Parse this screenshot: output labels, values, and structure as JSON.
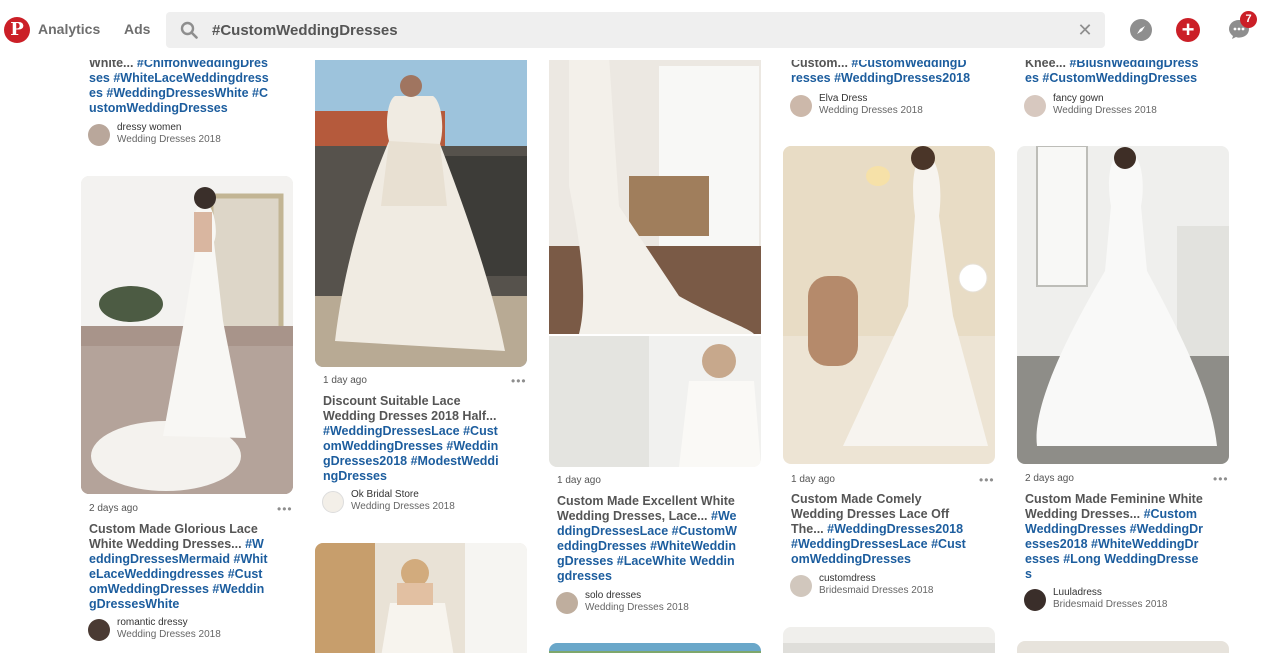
{
  "header": {
    "logo_glyph": "P",
    "analytics_label": "Analytics",
    "ads_label": "Ads",
    "search_value": "#CustomWeddingDresses",
    "clear_glyph": "✕",
    "create_glyph": "+",
    "notification_count": "7"
  },
  "icons": {
    "logo": "pinterest-logo-icon",
    "search": "search-icon",
    "clear": "close-icon",
    "explore": "compass-icon",
    "create": "plus-icon",
    "messages": "chat-icon"
  },
  "colors": {
    "brand_red": "#cb1f27",
    "tag_blue": "#1c5d9e",
    "search_bg": "#efefef"
  },
  "more_glyph": "•••",
  "pins": [
    {
      "lead": "White... ",
      "tags": "#ChiffonWeddingDresses #WhiteLaceWeddingdresses #WeddingDressesWhite #CustomWeddingDresses",
      "pinner": "dressy women",
      "board": "Wedding Dresses 2018"
    },
    {
      "time": "2 days ago",
      "lead": "Custom Made Glorious Lace White Wedding Dresses... ",
      "tags": "#WeddingDressesMermaid #WhiteLaceWeddingdresses #CustomWeddingDresses #WeddingDressesWhite",
      "pinner": "romantic dressy",
      "board": "Wedding Dresses 2018"
    },
    {
      "time": "1 day ago",
      "lead": "Discount Suitable Lace Wedding Dresses 2018 Half... ",
      "tags": "#WeddingDressesLace #CustomWeddingDresses #WeddingDresses2018 #ModestWeddingDresses",
      "pinner": "Ok Bridal Store",
      "board": "Wedding Dresses 2018"
    },
    {
      "time": "1 day ago",
      "lead": "Custom Made Excellent White Wedding Dresses, Lace... ",
      "tags": "#WeddingDressesLace #CustomWeddingDresses #WhiteWeddingDresses #LaceWhite Weddingdresses",
      "pinner": "solo dresses",
      "board": "Wedding Dresses 2018"
    },
    {
      "lead": "Custom... ",
      "tags": "#CustomWeddingDresses #WeddingDresses2018",
      "pinner": "Elva Dress",
      "board": "Wedding Dresses 2018"
    },
    {
      "time": "1 day ago",
      "lead": "Custom Made Comely Wedding Dresses Lace Off The... ",
      "tags": "#WeddingDresses2018 #WeddingDressesLace #CustomWeddingDresses",
      "pinner": "customdress",
      "board": "Bridesmaid Dresses 2018"
    },
    {
      "lead": "Knee... ",
      "tags": "#BlushWeddingDresses #CustomWeddingDresses",
      "pinner": "fancy gown",
      "board": "Wedding Dresses 2018"
    },
    {
      "time": "2 days ago",
      "lead": "Custom Made Feminine White Wedding Dresses... ",
      "tags": "#CustomWeddingDresses #WeddingDresses2018 #WhiteWeddingDresses #Long WeddingDresses",
      "pinner": "Luuladress",
      "board": "Bridesmaid Dresses 2018"
    }
  ]
}
